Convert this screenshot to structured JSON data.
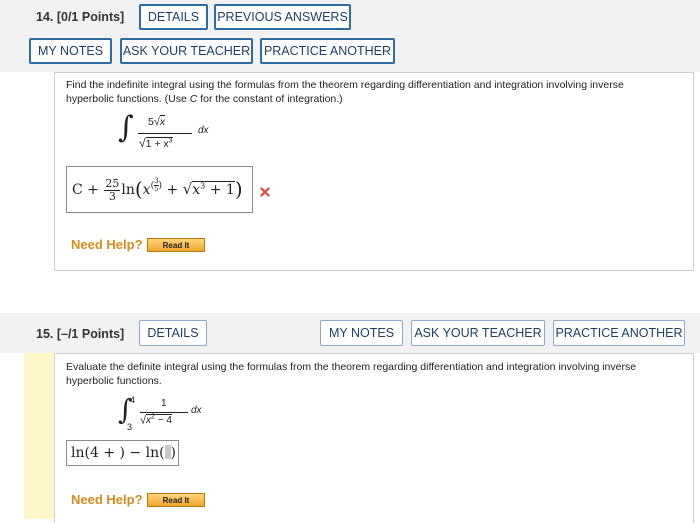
{
  "q14": {
    "number_label": "14. [0/1 Points]",
    "details_btn": "DETAILS",
    "prev_answers_btn": "PREVIOUS ANSWERS",
    "my_notes_btn": "MY NOTES",
    "ask_teacher_btn": "ASK YOUR TEACHER",
    "practice_btn": "PRACTICE ANOTHER",
    "prompt_line1": "Find the indefinite integral using the formulas from the theorem regarding differentiation and integration involving inverse",
    "prompt_line2_a": "hyperbolic functions. (Use ",
    "prompt_line2_c": "C",
    "prompt_line2_b": " for the constant of integration.)",
    "integral": {
      "num_coef": "5",
      "num_var": "x",
      "den_text": "1 + x",
      "den_exp": "3",
      "dx": "dx"
    },
    "answer": {
      "c_plus": "C + ",
      "frac_num": "25",
      "frac_den": "3",
      "ln": "ln",
      "x": "x",
      "exp_num": "3",
      "exp_den": "5",
      "plus": " + ",
      "rad_x": "x",
      "rad_exp": "3",
      "rad_rest": " + 1"
    },
    "status_icon": "incorrect-x-icon",
    "need_help": "Need Help?",
    "read_it": "Read It"
  },
  "q15": {
    "number_label": "15. [–/1 Points]",
    "details_btn": "DETAILS",
    "my_notes_btn": "MY NOTES",
    "ask_teacher_btn": "ASK YOUR TEACHER",
    "practice_btn": "PRACTICE ANOTHER",
    "prompt_line1": "Evaluate the definite integral using the formulas from the theorem regarding differentiation and integration involving inverse",
    "prompt_line2": "hyperbolic functions.",
    "integral": {
      "upper": "4",
      "lower": "3",
      "numerator": "1",
      "den_text": "x",
      "den_exp": "2",
      "den_rest": " − 4",
      "dx": "dx"
    },
    "answer": {
      "part1": "ln(4 + ) − ln(",
      "part2": ")"
    },
    "need_help": "Need Help?",
    "read_it": "Read It"
  },
  "colors": {
    "button_border": "#2e6da4",
    "need_help": "#d98a1e",
    "error_x": "#e04a3a",
    "sidebar_yellow": "#fdf6c8"
  }
}
